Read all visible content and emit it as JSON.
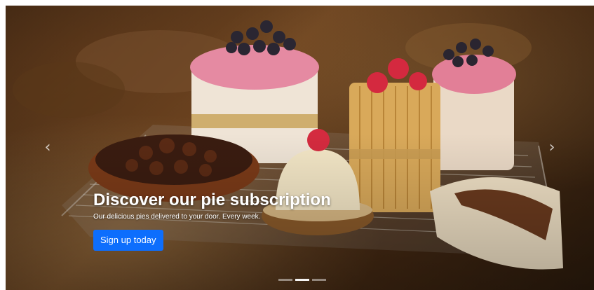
{
  "carousel": {
    "active_index": 2,
    "slide_count": 3,
    "image_subject": "assorted pastries on a wire rack",
    "prev_icon": "chevron-left-icon",
    "next_icon": "chevron-right-icon",
    "prev_glyph": "‹",
    "next_glyph": "›"
  },
  "caption": {
    "heading": "Discover our pie subscription",
    "subtext": "Our delicious pies delivered to your door. Every week.",
    "cta_label": "Sign up today"
  },
  "colors": {
    "cta_background": "#0d6efd",
    "caption_text": "#ffffff"
  }
}
